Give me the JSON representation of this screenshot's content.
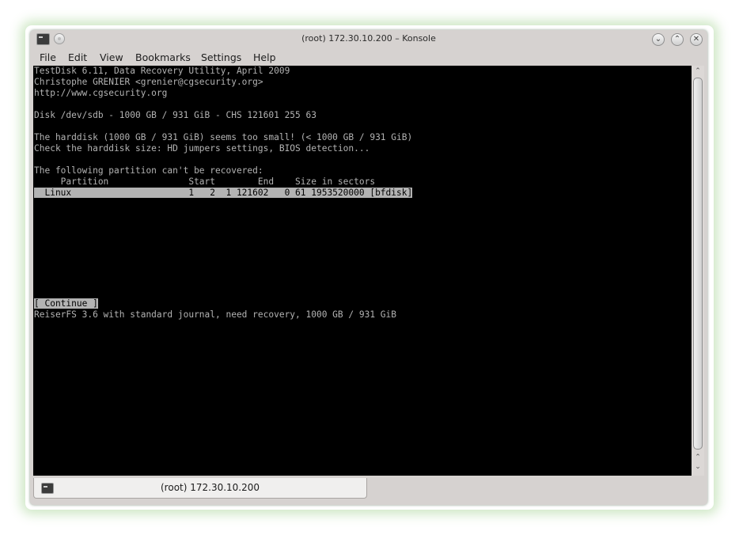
{
  "window": {
    "title": "(root) 172.30.10.200 – Konsole"
  },
  "menubar": {
    "items": [
      "File",
      "Edit",
      "View",
      "Bookmarks",
      "Settings",
      "Help"
    ]
  },
  "terminal": {
    "lines": {
      "l1": "TestDisk 6.11, Data Recovery Utility, April 2009",
      "l2": "Christophe GRENIER <grenier@cgsecurity.org>",
      "l3": "http://www.cgsecurity.org",
      "l4": "",
      "l5": "Disk /dev/sdb - 1000 GB / 931 GiB - CHS 121601 255 63",
      "l6": "",
      "l7": "The harddisk (1000 GB / 931 GiB) seems too small! (< 1000 GB / 931 GiB)",
      "l8": "Check the harddisk size: HD jumpers settings, BIOS detection...",
      "l9": "",
      "l10": "The following partition can't be recovered:",
      "l11": "     Partition               Start        End    Size in sectors",
      "l12": "  Linux                      1   2  1 121602   0 61 1953520000 [bfdisk]",
      "l13": "",
      "l14": "",
      "l15": "",
      "l16": "",
      "l17": "",
      "l18": "",
      "l19": "",
      "l20": "",
      "l21": "",
      "l22": "[ Continue ]",
      "l23": "ReiserFS 3.6 with standard journal, need recovery, 1000 GB / 931 GiB"
    }
  },
  "tabs": [
    {
      "label": "(root) 172.30.10.200"
    }
  ],
  "colors": {
    "terminal_bg": "#000000",
    "terminal_fg": "#b3b3b3",
    "glow": "#96cd82",
    "chrome": "#d6d2d0"
  },
  "icons": {
    "app": "terminal-icon",
    "pin": "pin-icon",
    "minimize": "chevron-down-icon",
    "maximize": "chevron-up-icon",
    "close": "close-icon",
    "scroll_up": "arrow-up-icon",
    "scroll_down": "arrow-down-icon"
  }
}
